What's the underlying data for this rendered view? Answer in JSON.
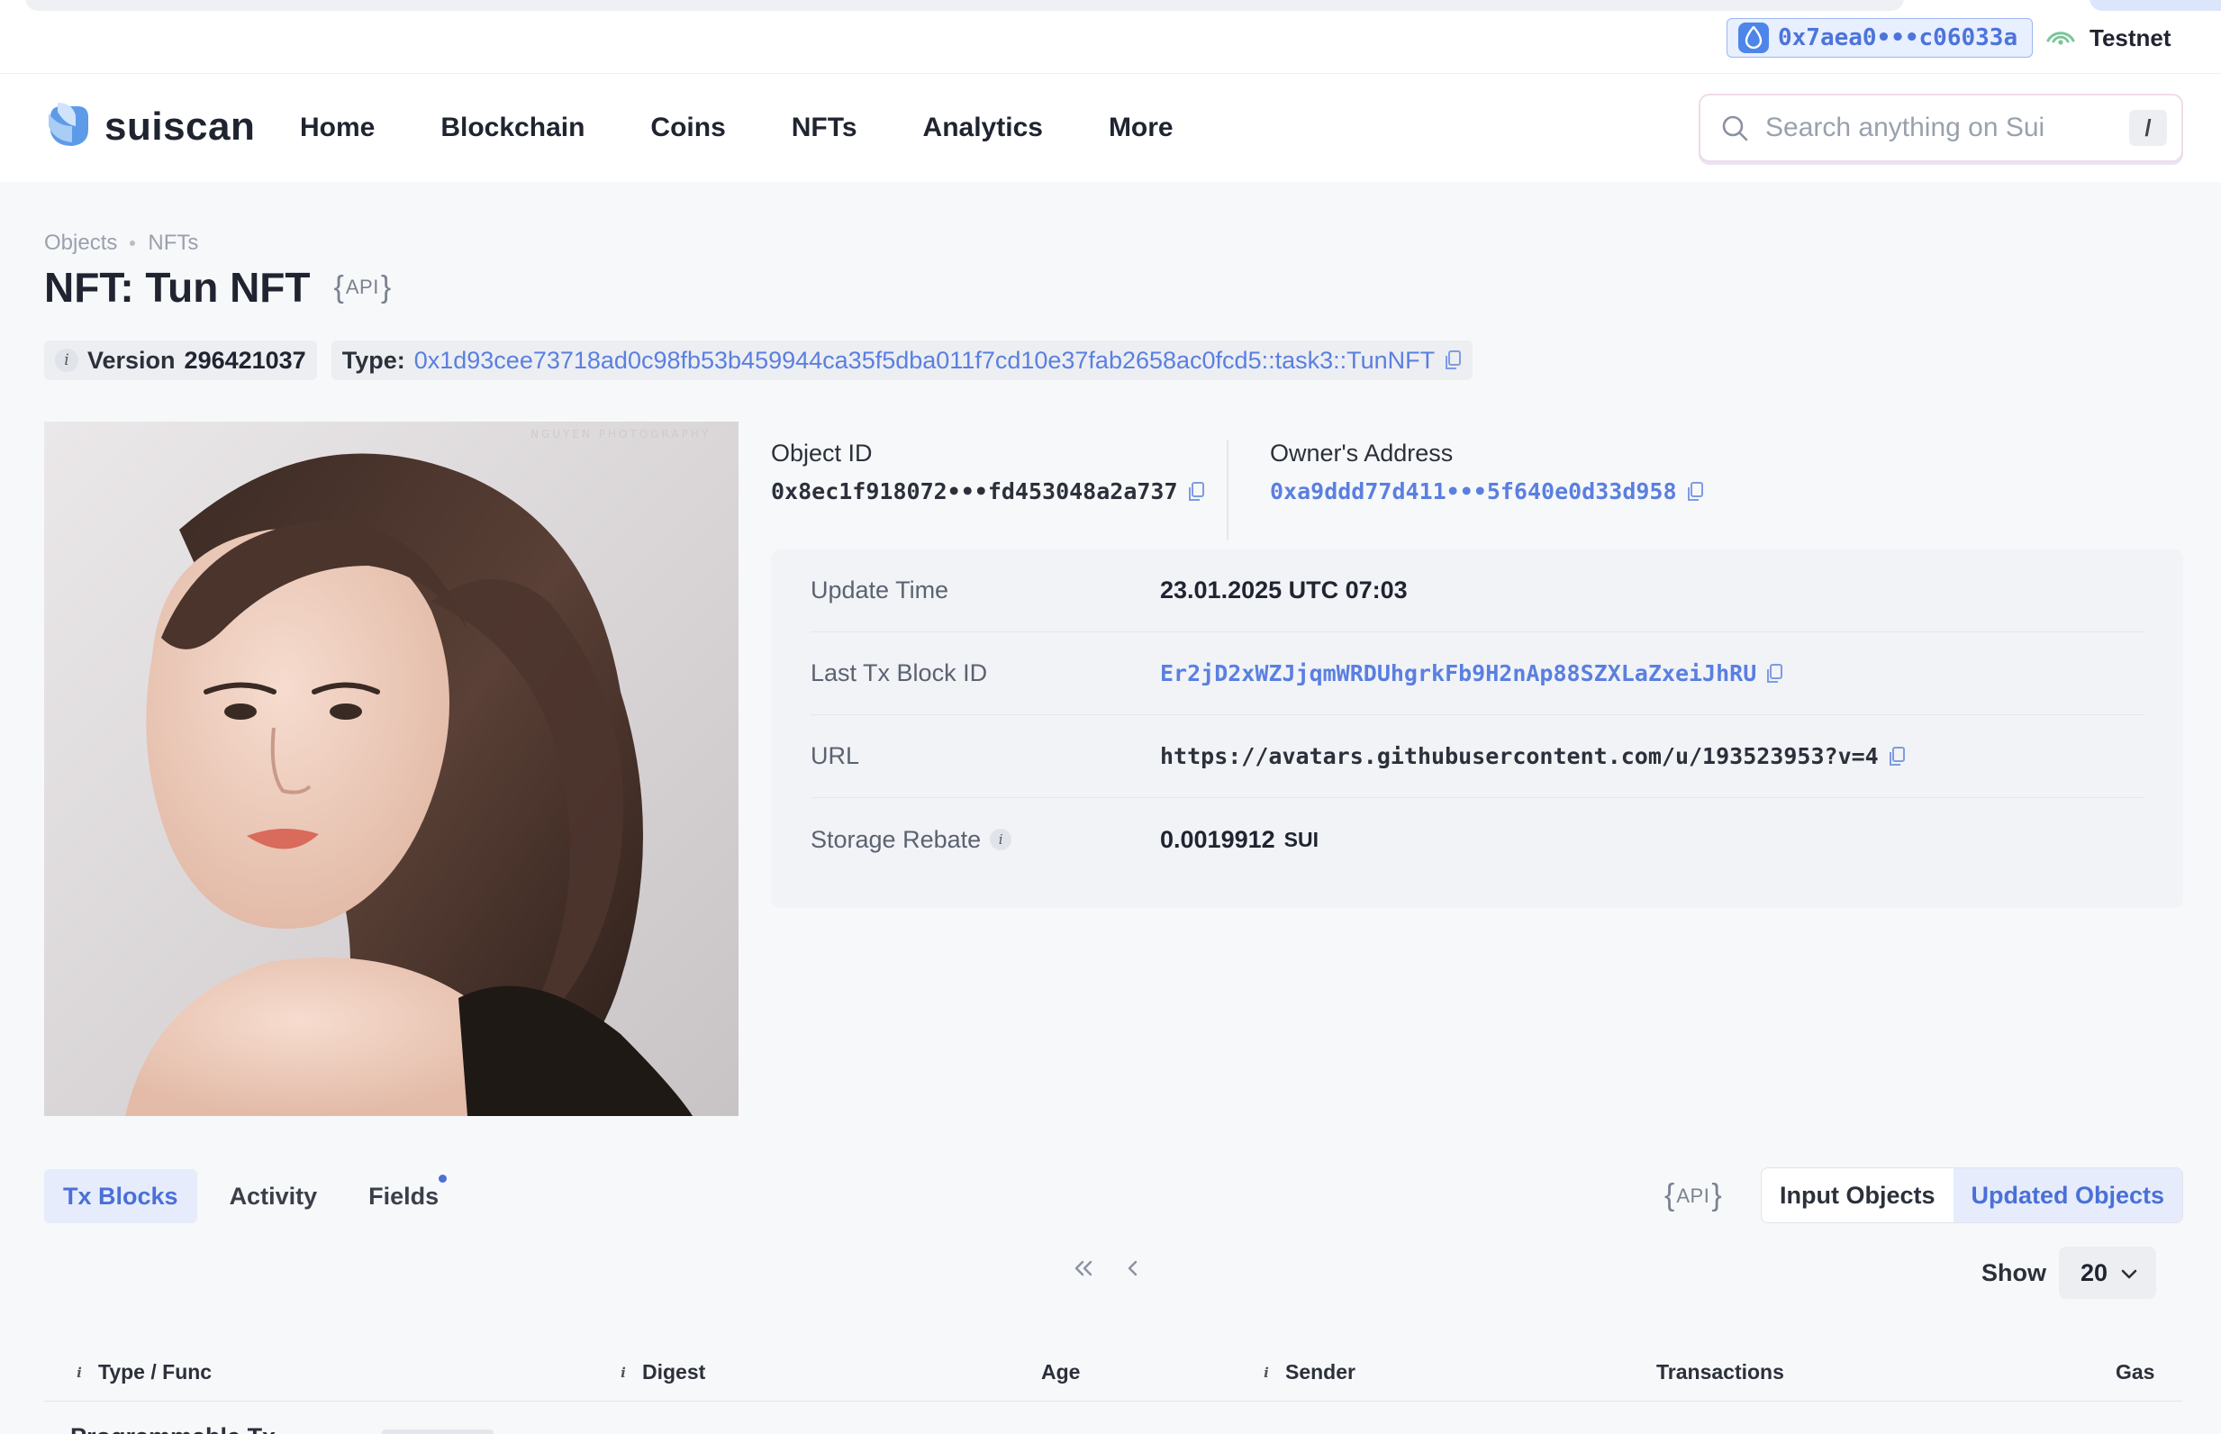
{
  "wallet": {
    "address": "0x7aea0•••c06033a"
  },
  "network": {
    "label": "Testnet"
  },
  "brand": {
    "name": "suiscan"
  },
  "nav": {
    "items": [
      "Home",
      "Blockchain",
      "Coins",
      "NFTs",
      "Analytics",
      "More"
    ]
  },
  "search": {
    "placeholder": "Search anything on Sui",
    "shortcut": "/"
  },
  "breadcrumb": {
    "items": [
      "Objects",
      "NFTs"
    ]
  },
  "page": {
    "title": "NFT: Tun NFT",
    "api_label": "API"
  },
  "chips": {
    "version_label": "Version",
    "version_value": "296421037",
    "type_label": "Type:",
    "type_value": "0x1d93cee73718ad0c98fb53b459944ca35f5dba011f7cd10e37fab2658ac0fcd5::task3::TunNFT"
  },
  "object": {
    "id_label": "Object ID",
    "id_value": "0x8ec1f918072•••fd453048a2a737",
    "owner_label": "Owner's Address",
    "owner_value": "0xa9ddd77d411•••5f640e0d33d958"
  },
  "details": {
    "update_time_label": "Update Time",
    "update_time_value": "23.01.2025 UTC 07:03",
    "last_tx_label": "Last Tx Block ID",
    "last_tx_value": "Er2jD2xWZJjqmWRDUhgrkFb9H2nAp88SZXLaZxeiJhRU",
    "url_label": "URL",
    "url_value": "https://avatars.githubusercontent.com/u/193523953?v=4",
    "storage_label": "Storage Rebate",
    "storage_value": "0.0019912",
    "storage_unit": "SUI"
  },
  "tabs": {
    "items": [
      "Tx Blocks",
      "Activity",
      "Fields"
    ],
    "active": "Tx Blocks"
  },
  "toggle": {
    "input": "Input Objects",
    "updated": "Updated Objects",
    "active": "Updated Objects"
  },
  "pager": {
    "first": "«",
    "prev": "‹"
  },
  "show": {
    "label": "Show",
    "value": "20"
  },
  "table": {
    "headers": [
      "Type / Func",
      "Digest",
      "Age",
      "Sender",
      "Transactions",
      "Gas"
    ],
    "first_row_type": "Programmable Tx"
  },
  "colors": {
    "accent": "#4a70d8",
    "link": "#5a7fe0",
    "background": "#f7f8fa"
  }
}
